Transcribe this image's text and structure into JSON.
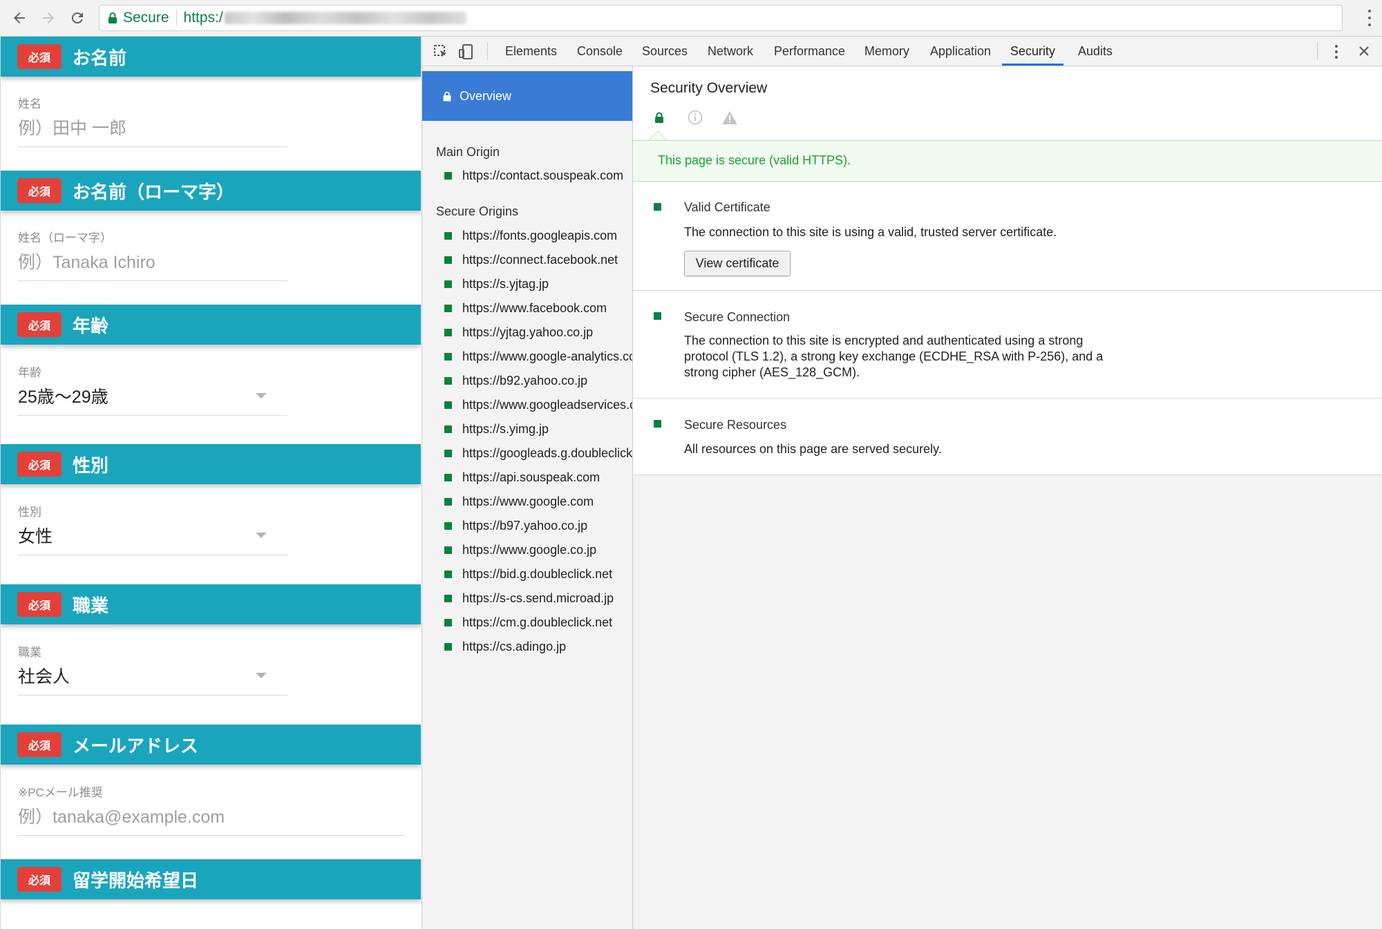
{
  "browser": {
    "secure_label": "Secure",
    "url_prefix": "https:/"
  },
  "form": {
    "required_badge": "必須",
    "sections": [
      {
        "title": "お名前",
        "field_label": "姓名",
        "value": "例）田中 一郎",
        "filled": false
      },
      {
        "title": "お名前（ローマ字）",
        "field_label": "姓名（ローマ字）",
        "value": "例）Tanaka Ichiro",
        "filled": false
      },
      {
        "title": "年齢",
        "field_label": "年齢",
        "value": "25歳〜29歳",
        "filled": true
      },
      {
        "title": "性別",
        "field_label": "性別",
        "value": "女性",
        "filled": true
      },
      {
        "title": "職業",
        "field_label": "職業",
        "value": "社会人",
        "filled": true
      },
      {
        "title": "メールアドレス",
        "field_label": "※PCメール推奨",
        "value": "例）tanaka@example.com",
        "filled": false
      },
      {
        "title": "留学開始希望日"
      }
    ]
  },
  "devtools": {
    "tabs": [
      "Elements",
      "Console",
      "Sources",
      "Network",
      "Performance",
      "Memory",
      "Application",
      "Security",
      "Audits"
    ],
    "active_tab": "Security",
    "sidebar": {
      "overview": "Overview",
      "main_origin_heading": "Main Origin",
      "main_origin": "https://contact.souspeak.com",
      "secure_origins_heading": "Secure Origins",
      "secure_origins": [
        "https://fonts.googleapis.com",
        "https://connect.facebook.net",
        "https://s.yjtag.jp",
        "https://www.facebook.com",
        "https://yjtag.yahoo.co.jp",
        "https://www.google-analytics.com",
        "https://b92.yahoo.co.jp",
        "https://www.googleadservices.com",
        "https://s.yimg.jp",
        "https://googleads.g.doubleclick.net",
        "https://api.souspeak.com",
        "https://www.google.com",
        "https://b97.yahoo.co.jp",
        "https://www.google.co.jp",
        "https://bid.g.doubleclick.net",
        "https://s-cs.send.microad.jp",
        "https://cm.g.doubleclick.net",
        "https://cs.adingo.jp"
      ]
    },
    "overview": {
      "title": "Security Overview",
      "banner": "This page is secure (valid HTTPS).",
      "certificate": {
        "title": "Valid Certificate",
        "description": "The connection to this site is using a valid, trusted server certificate.",
        "button": "View certificate"
      },
      "connection": {
        "title": "Secure Connection",
        "description": "The connection to this site is encrypted and authenticated using a strong protocol (TLS 1.2), a strong key exchange (ECDHE_RSA with P-256), and a strong cipher (AES_128_GCM)."
      },
      "resources": {
        "title": "Secure Resources",
        "description": "All resources on this page are served securely."
      }
    }
  },
  "colors": {
    "section_header": "#1aa5bd",
    "required_badge": "#e3403a",
    "secure_green": "#0b8043",
    "devtools_selected": "#3a7bd5",
    "active_tab_underline": "#1a73e8"
  },
  "icons": [
    "back-arrow-icon",
    "forward-arrow-icon",
    "reload-icon",
    "lock-icon",
    "kebab-menu-icon",
    "inspect-element-icon",
    "device-toolbar-icon",
    "close-icon",
    "info-icon",
    "warning-icon"
  ]
}
